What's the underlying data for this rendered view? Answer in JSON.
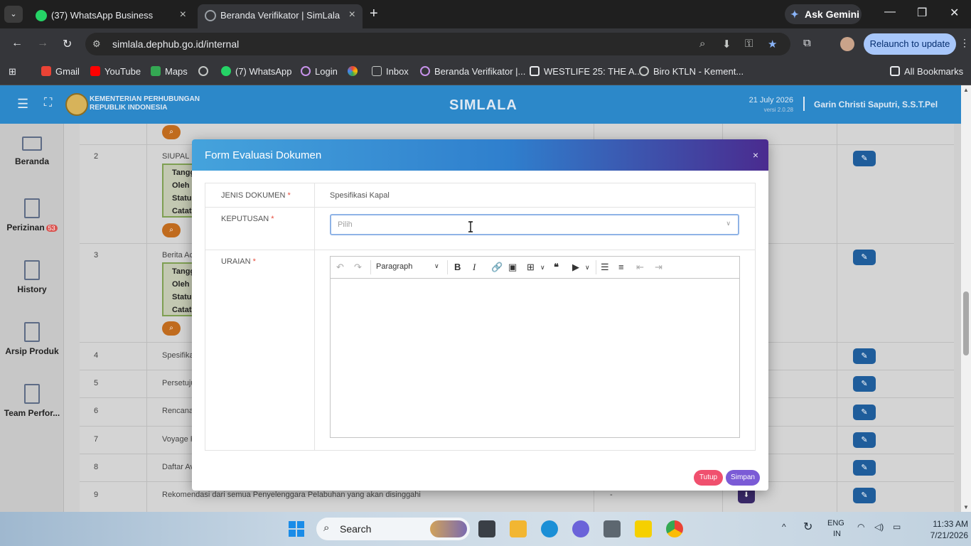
{
  "browser": {
    "tabs": [
      {
        "label": "(37) WhatsApp Business",
        "badge": "37"
      },
      {
        "label": "Beranda Verifikator | SimLala"
      }
    ],
    "ask_gemini": "Ask Gemini",
    "url": "simlala.dephub.go.id/internal",
    "relaunch": "Relaunch to update",
    "bookmarks": [
      "Gmail",
      "YouTube",
      "Maps",
      "(7) WhatsApp",
      "Login",
      "Inbox",
      "Beranda Verifikator |...",
      "WESTLIFE 25: THE A...",
      "Biro KTLN - Kement..."
    ],
    "all_bookmarks": "All Bookmarks"
  },
  "app": {
    "ministry_line1": "KEMENTERIAN PERHUBUNGAN",
    "ministry_line2": "REPUBLIK INDONESIA",
    "title": "SIMLALA",
    "date": "21 July 2026",
    "version": "versi 2.0.28",
    "user": "Garin Christi Saputri, S.S.T.Pel"
  },
  "sidebar": [
    {
      "label": "Beranda"
    },
    {
      "label": "Perizinan",
      "badge": "53"
    },
    {
      "label": "History"
    },
    {
      "label": "Arsip Produk"
    },
    {
      "label": "Team Perfor..."
    }
  ],
  "table": {
    "rows": [
      {
        "no": "2",
        "name": "SIUPAL"
      },
      {
        "no": "3",
        "name": "Berita Ac"
      },
      {
        "no": "4",
        "name": "Spesifikas"
      },
      {
        "no": "5",
        "name": "Persetuju"
      },
      {
        "no": "6",
        "name": "Rencana"
      },
      {
        "no": "7",
        "name": "Voyage R"
      },
      {
        "no": "8",
        "name": "Daftar Av"
      },
      {
        "no": "9",
        "name": "Rekomendasi dari semua Penyelenggara Pelabuhan yang akan disinggahi",
        "extra": "-"
      }
    ],
    "note_lines": [
      "Tangg",
      "Oleh :",
      "Status",
      "Catata"
    ]
  },
  "modal": {
    "title": "Form Evaluasi Dokumen",
    "close": "×",
    "fields": {
      "jenis_label": "JENIS DOKUMEN",
      "jenis_value": "Spesifikasi Kapal",
      "keputusan_label": "KEPUTUSAN",
      "keputusan_placeholder": "Pilih",
      "uraian_label": "URAIAN",
      "required_mark": "*"
    },
    "editor": {
      "paragraph": "Paragraph"
    },
    "buttons": {
      "tutup": "Tutup",
      "simpan": "Simpan"
    }
  },
  "taskbar": {
    "search": "Search",
    "lang1": "ENG",
    "lang2": "IN",
    "time": "11:33 AM",
    "date": "7/21/2026"
  },
  "colors": {
    "header": "#2c88c9",
    "modal_gradient_start": "#45a3dc",
    "modal_gradient_end": "#4a2b8f",
    "tutup": "#f0506e",
    "simpan": "#7b5bd6"
  }
}
